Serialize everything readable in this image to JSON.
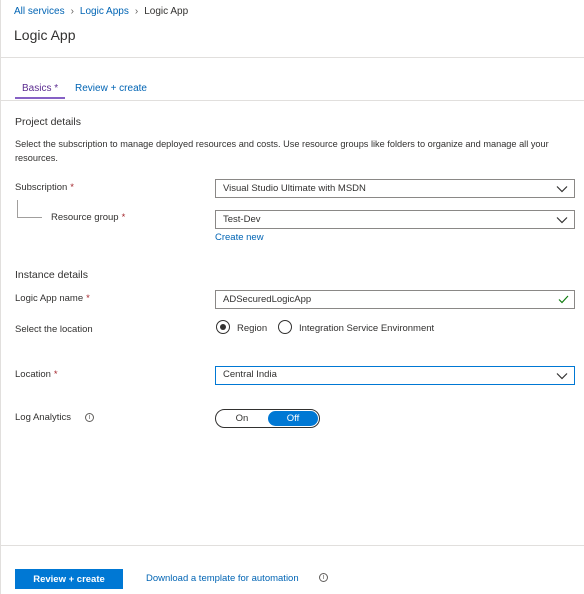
{
  "breadcrumb": {
    "items": [
      "All services",
      "Logic Apps"
    ],
    "current": "Logic App"
  },
  "page": {
    "title": "Logic App"
  },
  "tabs": [
    {
      "label": "Basics *"
    },
    {
      "label": "Review + create"
    }
  ],
  "project": {
    "heading": "Project details",
    "description": "Select the subscription to manage deployed resources and costs. Use resource groups like folders to organize and manage all your resources.",
    "subscription_label": "Subscription",
    "subscription_value": "Visual Studio Ultimate with MSDN",
    "resource_group_label": "Resource group",
    "resource_group_value": "Test-Dev",
    "create_new": "Create new"
  },
  "instance": {
    "heading": "Instance details",
    "name_label": "Logic App name",
    "name_value": "ADSecuredLogicApp",
    "location_select_label": "Select the location",
    "radio_region": "Region",
    "radio_ise": "Integration Service Environment",
    "location_label": "Location",
    "location_value": "Central India",
    "log_analytics_label": "Log Analytics",
    "toggle_on": "On",
    "toggle_off": "Off"
  },
  "required_mark": "*",
  "footer": {
    "review_button": "Review + create",
    "download_link": "Download a template for automation"
  },
  "colors": {
    "accent": "#0078d4",
    "link": "#0064b4",
    "tab_active": "#5c2d91",
    "required": "#a4262c",
    "valid": "#107c10"
  }
}
